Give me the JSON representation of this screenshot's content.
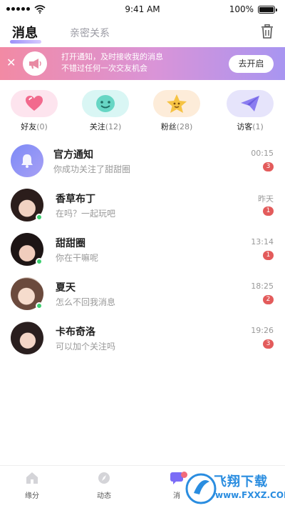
{
  "status_bar": {
    "time": "9:41 AM",
    "battery": "100%"
  },
  "header": {
    "tabs": [
      {
        "label": "消息",
        "active": true
      },
      {
        "label": "亲密关系",
        "active": false
      }
    ],
    "trash_icon": "trash-icon"
  },
  "banner": {
    "close_icon": "close-icon",
    "icon": "megaphone-icon",
    "line1": "打开通知，及时接收我的消息",
    "line2": "不错过任何一次交友机会",
    "button": "去开启"
  },
  "quick": [
    {
      "label": "好友",
      "count": "(0)",
      "icon": "heart-icon",
      "color": "#fde4ee"
    },
    {
      "label": "关注",
      "count": "(12)",
      "icon": "smile-icon",
      "color": "#d9f6f4"
    },
    {
      "label": "粉丝",
      "count": "(28)",
      "icon": "star-icon",
      "color": "#fdecd9"
    },
    {
      "label": "访客",
      "count": "(1)",
      "icon": "paper-plane-icon",
      "color": "#e6e4fb"
    }
  ],
  "messages": [
    {
      "name": "官方通知",
      "preview": "你成功关注了甜甜圈",
      "time": "00:15",
      "unread": "3",
      "online": false
    },
    {
      "name": "香草布丁",
      "preview": "在吗？一起玩吧",
      "time": "昨天",
      "unread": "1",
      "online": true
    },
    {
      "name": "甜甜圈",
      "preview": "你在干嘛呢",
      "time": "13:14",
      "unread": "1",
      "online": true
    },
    {
      "name": "夏天",
      "preview": "怎么不回我消息",
      "time": "18:25",
      "unread": "2",
      "online": true
    },
    {
      "name": "卡布奇洛",
      "preview": "可以加个关注吗",
      "time": "19:26",
      "unread": "3",
      "online": false
    }
  ],
  "tabbar": [
    {
      "label": "缘分",
      "icon": "home-icon",
      "active": false
    },
    {
      "label": "动态",
      "icon": "compass-icon",
      "active": false
    },
    {
      "label": "消",
      "icon": "message-icon",
      "active": true
    }
  ],
  "watermark": {
    "title": "飞翔下载",
    "url": "www.FXXZ.COM"
  }
}
